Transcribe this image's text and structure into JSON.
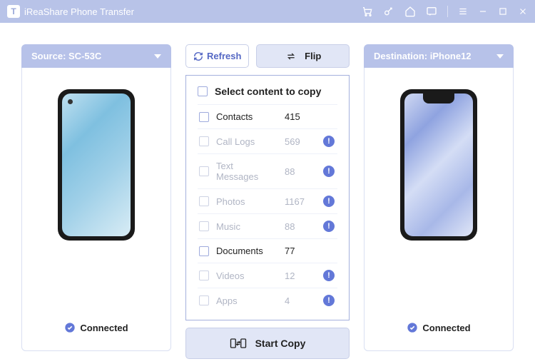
{
  "app": {
    "title": "iReaShare Phone Transfer",
    "logo_letter": "T"
  },
  "source": {
    "header_prefix": "Source: ",
    "name": "SC-53C",
    "status": "Connected"
  },
  "destination": {
    "header_prefix": "Destination: ",
    "name": "iPhone12",
    "status": "Connected"
  },
  "buttons": {
    "refresh": "Refresh",
    "flip": "Flip",
    "start": "Start Copy"
  },
  "content": {
    "select_all_label": "Select content to copy",
    "items": [
      {
        "label": "Contacts",
        "count": "415",
        "enabled": true,
        "warn": false
      },
      {
        "label": "Call Logs",
        "count": "569",
        "enabled": false,
        "warn": true
      },
      {
        "label": "Text Messages",
        "count": "88",
        "enabled": false,
        "warn": true
      },
      {
        "label": "Photos",
        "count": "1167",
        "enabled": false,
        "warn": true
      },
      {
        "label": "Music",
        "count": "88",
        "enabled": false,
        "warn": true
      },
      {
        "label": "Documents",
        "count": "77",
        "enabled": true,
        "warn": false
      },
      {
        "label": "Videos",
        "count": "12",
        "enabled": false,
        "warn": true
      },
      {
        "label": "Apps",
        "count": "4",
        "enabled": false,
        "warn": true
      }
    ]
  }
}
